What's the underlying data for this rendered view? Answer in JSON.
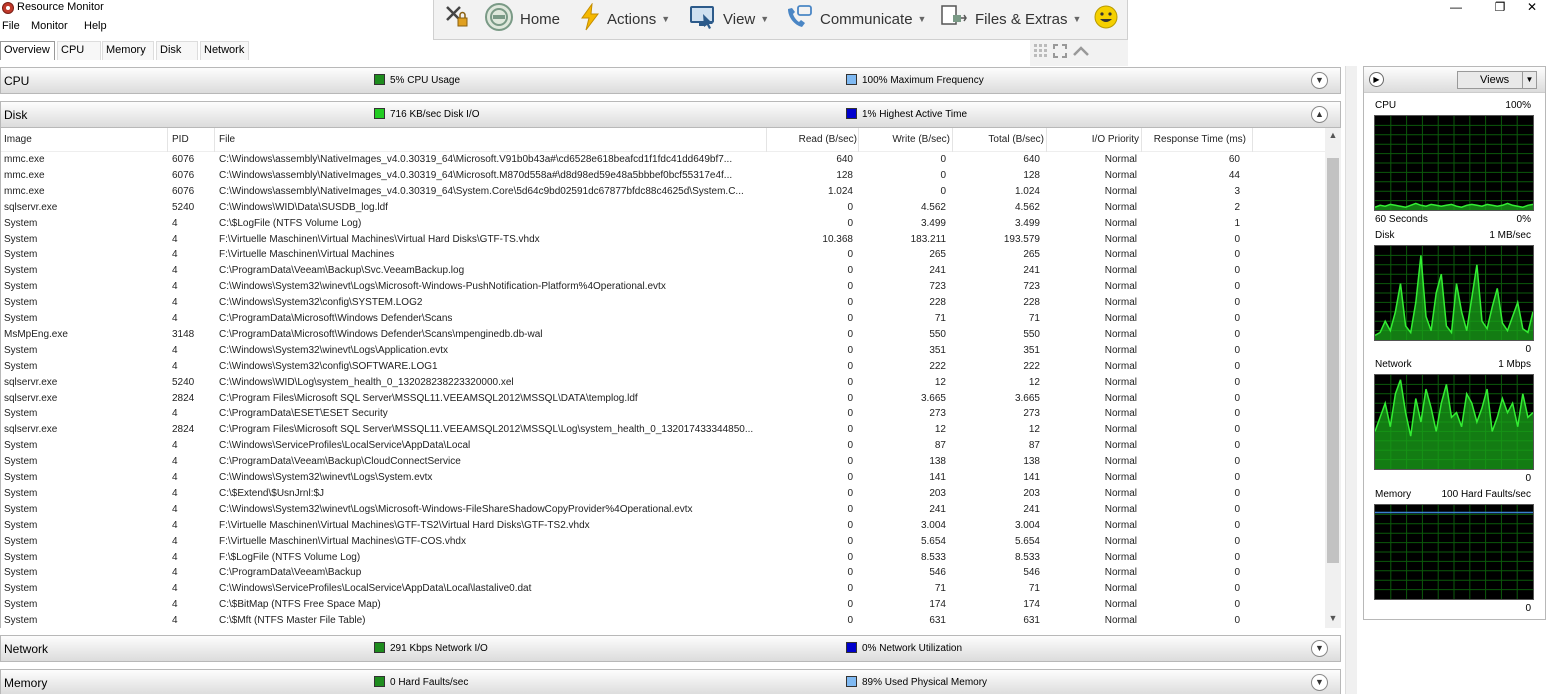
{
  "window": {
    "title": "Resource Monitor",
    "minimize": "—",
    "restore": "❐",
    "close": "✕"
  },
  "menu": [
    "File",
    "Monitor",
    "Help"
  ],
  "remote_toolbar": {
    "home": "Home",
    "actions": "Actions",
    "view": "View",
    "communicate": "Communicate",
    "files": "Files & Extras"
  },
  "tabs": [
    "Overview",
    "CPU",
    "Memory",
    "Disk",
    "Network"
  ],
  "sections": {
    "cpu": {
      "title": "CPU",
      "stat1": "5% CPU Usage",
      "stat2": "100% Maximum Frequency",
      "color1": "#1e8c1e",
      "color2": "#7fb9f2"
    },
    "disk": {
      "title": "Disk",
      "stat1": "716 KB/sec Disk I/O",
      "stat2": "1% Highest Active Time",
      "color1": "#22cc22",
      "color2": "#0000cc"
    },
    "network": {
      "title": "Network",
      "stat1": "291 Kbps Network I/O",
      "stat2": "0% Network Utilization",
      "color1": "#1e8c1e",
      "color2": "#0000cc"
    },
    "memory": {
      "title": "Memory",
      "stat1": "0 Hard Faults/sec",
      "stat2": "89% Used Physical Memory",
      "color1": "#1e8c1e",
      "color2": "#7fb9f2"
    }
  },
  "disk_table": {
    "columns": [
      "Image",
      "PID",
      "File",
      "Read (B/sec)",
      "Write (B/sec)",
      "Total (B/sec)",
      "I/O Priority",
      "Response Time (ms)"
    ],
    "rows": [
      [
        "mmc.exe",
        "6076",
        "C:\\Windows\\assembly\\NativeImages_v4.0.30319_64\\Microsoft.V91b0b43a#\\cd6528e618beafcd1f1fdc41dd649bf7...",
        "640",
        "0",
        "640",
        "Normal",
        "60"
      ],
      [
        "mmc.exe",
        "6076",
        "C:\\Windows\\assembly\\NativeImages_v4.0.30319_64\\Microsoft.M870d558a#\\d8d98ed59e48a5bbbef0bcf55317e4f...",
        "128",
        "0",
        "128",
        "Normal",
        "44"
      ],
      [
        "mmc.exe",
        "6076",
        "C:\\Windows\\assembly\\NativeImages_v4.0.30319_64\\System.Core\\5d64c9bd02591dc67877bfdc88c4625d\\System.C...",
        "1.024",
        "0",
        "1.024",
        "Normal",
        "3"
      ],
      [
        "sqlservr.exe",
        "5240",
        "C:\\Windows\\WID\\Data\\SUSDB_log.ldf",
        "0",
        "4.562",
        "4.562",
        "Normal",
        "2"
      ],
      [
        "System",
        "4",
        "C:\\$LogFile (NTFS Volume Log)",
        "0",
        "3.499",
        "3.499",
        "Normal",
        "1"
      ],
      [
        "System",
        "4",
        "F:\\Virtuelle Maschinen\\Virtual Machines\\Virtual Hard Disks\\GTF-TS.vhdx",
        "10.368",
        "183.211",
        "193.579",
        "Normal",
        "0"
      ],
      [
        "System",
        "4",
        "F:\\Virtuelle Maschinen\\Virtual Machines",
        "0",
        "265",
        "265",
        "Normal",
        "0"
      ],
      [
        "System",
        "4",
        "C:\\ProgramData\\Veeam\\Backup\\Svc.VeeamBackup.log",
        "0",
        "241",
        "241",
        "Normal",
        "0"
      ],
      [
        "System",
        "4",
        "C:\\Windows\\System32\\winevt\\Logs\\Microsoft-Windows-PushNotification-Platform%4Operational.evtx",
        "0",
        "723",
        "723",
        "Normal",
        "0"
      ],
      [
        "System",
        "4",
        "C:\\Windows\\System32\\config\\SYSTEM.LOG2",
        "0",
        "228",
        "228",
        "Normal",
        "0"
      ],
      [
        "System",
        "4",
        "C:\\ProgramData\\Microsoft\\Windows Defender\\Scans",
        "0",
        "71",
        "71",
        "Normal",
        "0"
      ],
      [
        "MsMpEng.exe",
        "3148",
        "C:\\ProgramData\\Microsoft\\Windows Defender\\Scans\\mpenginedb.db-wal",
        "0",
        "550",
        "550",
        "Normal",
        "0"
      ],
      [
        "System",
        "4",
        "C:\\Windows\\System32\\winevt\\Logs\\Application.evtx",
        "0",
        "351",
        "351",
        "Normal",
        "0"
      ],
      [
        "System",
        "4",
        "C:\\Windows\\System32\\config\\SOFTWARE.LOG1",
        "0",
        "222",
        "222",
        "Normal",
        "0"
      ],
      [
        "sqlservr.exe",
        "5240",
        "C:\\Windows\\WID\\Log\\system_health_0_132028238223320000.xel",
        "0",
        "12",
        "12",
        "Normal",
        "0"
      ],
      [
        "sqlservr.exe",
        "2824",
        "C:\\Program Files\\Microsoft SQL Server\\MSSQL11.VEEAMSQL2012\\MSSQL\\DATA\\templog.ldf",
        "0",
        "3.665",
        "3.665",
        "Normal",
        "0"
      ],
      [
        "System",
        "4",
        "C:\\ProgramData\\ESET\\ESET Security",
        "0",
        "273",
        "273",
        "Normal",
        "0"
      ],
      [
        "sqlservr.exe",
        "2824",
        "C:\\Program Files\\Microsoft SQL Server\\MSSQL11.VEEAMSQL2012\\MSSQL\\Log\\system_health_0_132017433344850...",
        "0",
        "12",
        "12",
        "Normal",
        "0"
      ],
      [
        "System",
        "4",
        "C:\\Windows\\ServiceProfiles\\LocalService\\AppData\\Local",
        "0",
        "87",
        "87",
        "Normal",
        "0"
      ],
      [
        "System",
        "4",
        "C:\\ProgramData\\Veeam\\Backup\\CloudConnectService",
        "0",
        "138",
        "138",
        "Normal",
        "0"
      ],
      [
        "System",
        "4",
        "C:\\Windows\\System32\\winevt\\Logs\\System.evtx",
        "0",
        "141",
        "141",
        "Normal",
        "0"
      ],
      [
        "System",
        "4",
        "C:\\$Extend\\$UsnJrnl:$J",
        "0",
        "203",
        "203",
        "Normal",
        "0"
      ],
      [
        "System",
        "4",
        "C:\\Windows\\System32\\winevt\\Logs\\Microsoft-Windows-FileShareShadowCopyProvider%4Operational.evtx",
        "0",
        "241",
        "241",
        "Normal",
        "0"
      ],
      [
        "System",
        "4",
        "F:\\Virtuelle Maschinen\\Virtual Machines\\GTF-TS2\\Virtual Hard Disks\\GTF-TS2.vhdx",
        "0",
        "3.004",
        "3.004",
        "Normal",
        "0"
      ],
      [
        "System",
        "4",
        "F:\\Virtuelle Maschinen\\Virtual Machines\\GTF-COS.vhdx",
        "0",
        "5.654",
        "5.654",
        "Normal",
        "0"
      ],
      [
        "System",
        "4",
        "F:\\$LogFile (NTFS Volume Log)",
        "0",
        "8.533",
        "8.533",
        "Normal",
        "0"
      ],
      [
        "System",
        "4",
        "C:\\ProgramData\\Veeam\\Backup",
        "0",
        "546",
        "546",
        "Normal",
        "0"
      ],
      [
        "System",
        "4",
        "C:\\Windows\\ServiceProfiles\\LocalService\\AppData\\Local\\lastalive0.dat",
        "0",
        "71",
        "71",
        "Normal",
        "0"
      ],
      [
        "System",
        "4",
        "C:\\$BitMap (NTFS Free Space Map)",
        "0",
        "174",
        "174",
        "Normal",
        "0"
      ],
      [
        "System",
        "4",
        "C:\\$Mft (NTFS Master File Table)",
        "0",
        "631",
        "631",
        "Normal",
        "0"
      ]
    ]
  },
  "right_pane": {
    "views_label": "Views",
    "graphs": {
      "cpu": {
        "label": "CPU",
        "max": "100%",
        "time": "60 Seconds",
        "min": "0%"
      },
      "disk": {
        "label": "Disk",
        "max": "1 MB/sec",
        "min": "0"
      },
      "network": {
        "label": "Network",
        "max": "1 Mbps",
        "min": "0"
      },
      "memory": {
        "label": "Memory",
        "max": "100 Hard Faults/sec",
        "min": "0"
      }
    },
    "series": {
      "cpu": [
        3,
        5,
        4,
        6,
        5,
        4,
        3,
        5,
        7,
        5,
        4,
        6,
        5,
        4,
        5,
        6,
        4,
        3,
        5,
        6,
        5,
        4,
        6,
        5,
        4,
        5,
        7,
        5,
        4,
        3,
        5,
        6
      ],
      "disk": [
        5,
        8,
        20,
        10,
        30,
        60,
        15,
        8,
        40,
        90,
        25,
        10,
        50,
        70,
        15,
        8,
        60,
        30,
        10,
        45,
        80,
        20,
        12,
        35,
        55,
        18,
        10,
        25,
        40,
        12,
        8,
        30
      ],
      "network": [
        40,
        55,
        70,
        45,
        80,
        95,
        60,
        35,
        75,
        50,
        85,
        65,
        40,
        70,
        90,
        55,
        60,
        45,
        80,
        70,
        50,
        65,
        85,
        40,
        55,
        75,
        60,
        70,
        45,
        80,
        55,
        60
      ],
      "memory": [
        92,
        92,
        92,
        92,
        92,
        92,
        92,
        92,
        92,
        92,
        92,
        92,
        92,
        92,
        92,
        92,
        92,
        92,
        92,
        92,
        92,
        92,
        92,
        92,
        92,
        92,
        92,
        92,
        92,
        92,
        92,
        92
      ]
    }
  }
}
